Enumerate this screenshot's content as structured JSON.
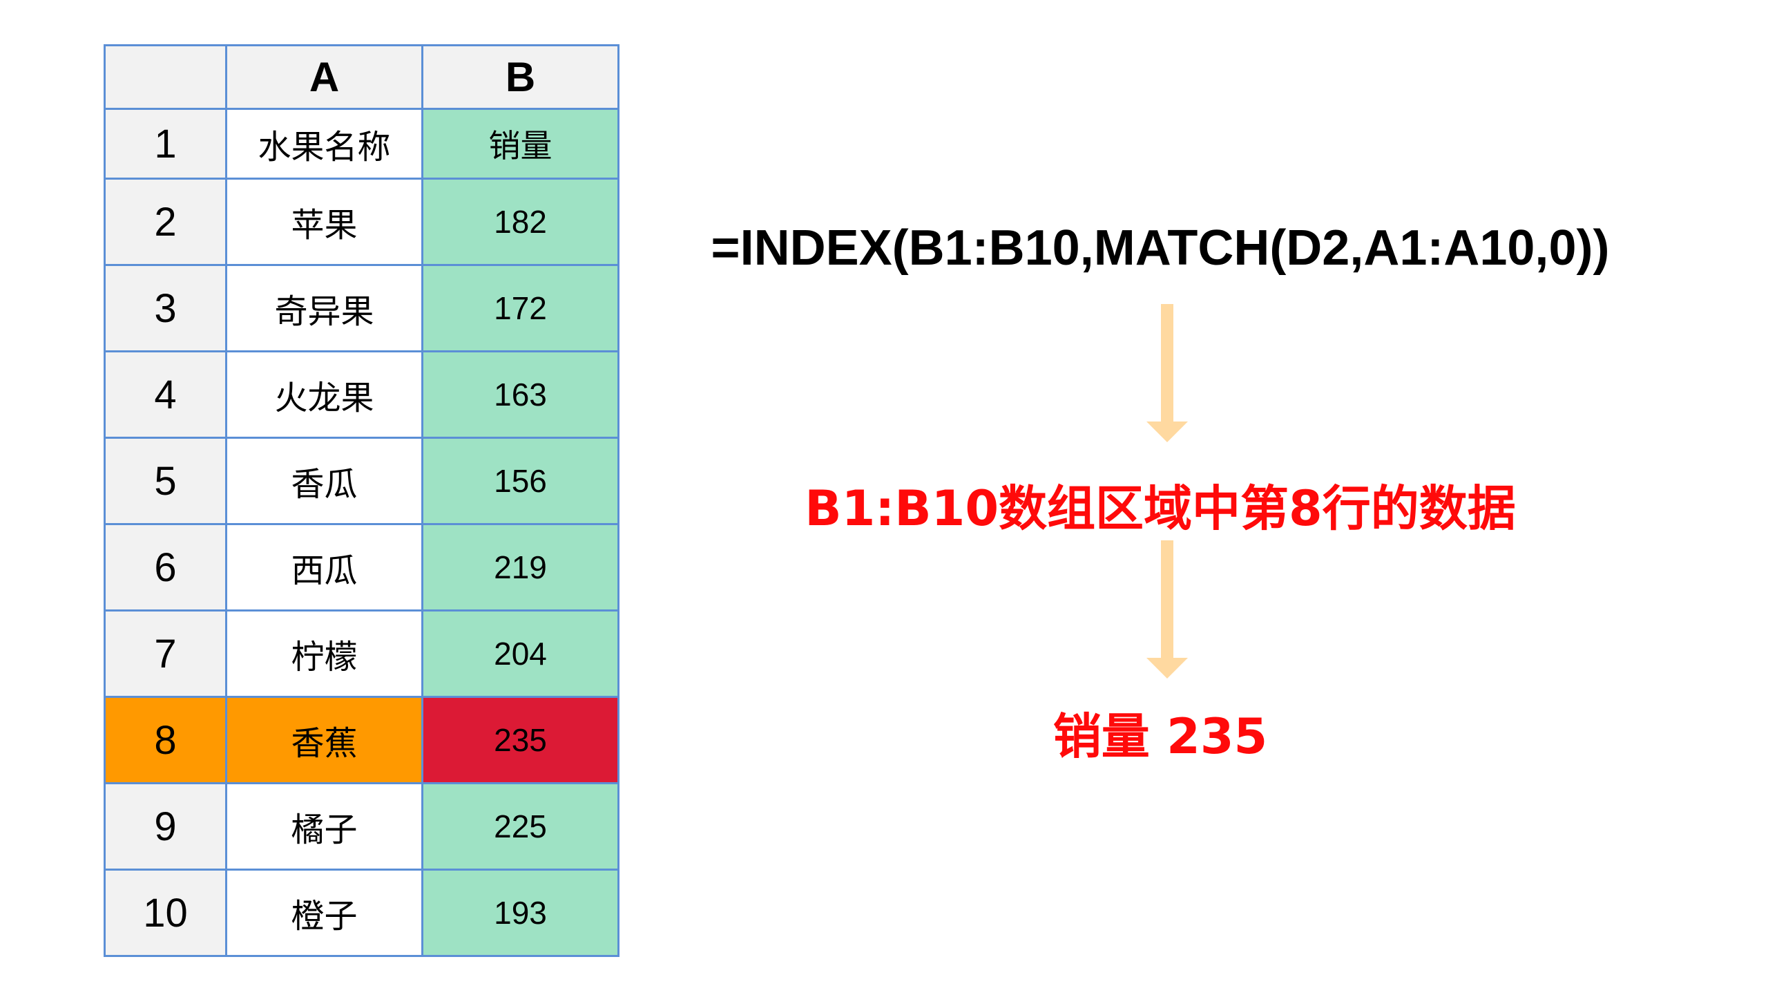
{
  "sheet": {
    "corner": "",
    "columns": [
      "A",
      "B"
    ],
    "rows": [
      {
        "num": "1",
        "a": "水果名称",
        "b": "销量"
      },
      {
        "num": "2",
        "a": "苹果",
        "b": "182"
      },
      {
        "num": "3",
        "a": "奇异果",
        "b": "172"
      },
      {
        "num": "4",
        "a": "火龙果",
        "b": "163"
      },
      {
        "num": "5",
        "a": "香瓜",
        "b": "156"
      },
      {
        "num": "6",
        "a": "西瓜",
        "b": "219"
      },
      {
        "num": "7",
        "a": "柠檬",
        "b": "204"
      },
      {
        "num": "8",
        "a": "香蕉",
        "b": "235"
      },
      {
        "num": "9",
        "a": "橘子",
        "b": "225"
      },
      {
        "num": "10",
        "a": "橙子",
        "b": "193"
      }
    ],
    "highlight_row": "8"
  },
  "flow": {
    "formula": "=INDEX(B1:B10,MATCH(D2,A1:A10,0))",
    "description": "B1:B10数组区域中第8行的数据",
    "result": "销量 235"
  },
  "colors": {
    "grid_border": "#5b8fd6",
    "header_bg": "#f2f2f2",
    "column_b_bg": "#9ee2c4",
    "highlight_row_bg": "#ff9900",
    "highlight_cell_bg": "#dc1a35",
    "arrow": "#ffd9a0",
    "emphasis_text": "#ff0a0a"
  },
  "icons": [
    "down-arrow-icon",
    "down-arrow-icon"
  ]
}
